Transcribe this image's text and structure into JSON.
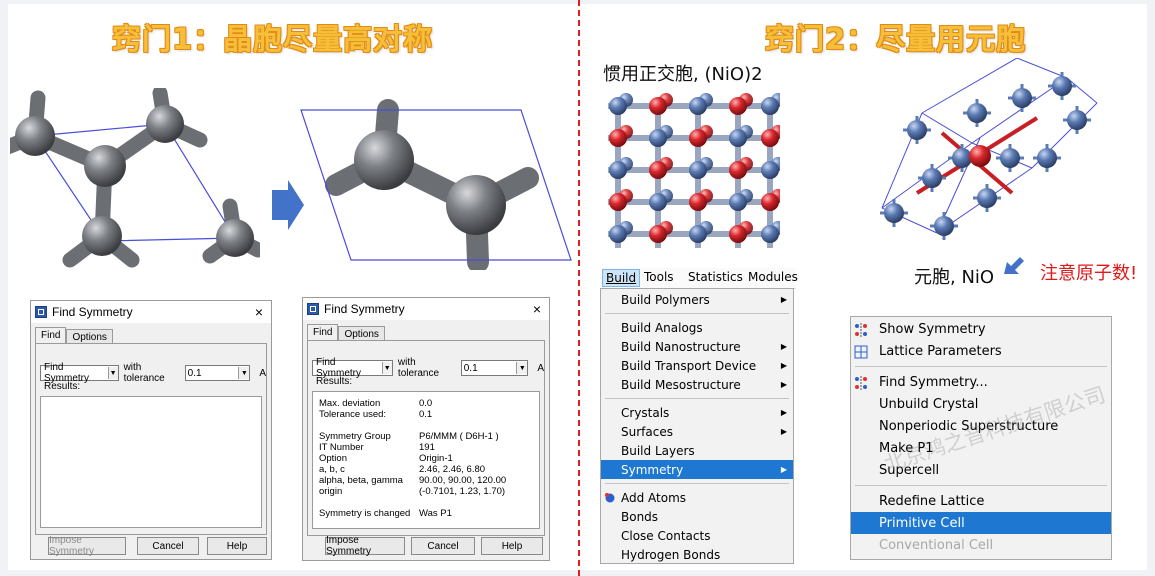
{
  "left_title": "窍门1：晶胞尽量高对称",
  "right_title": "窍门2：尽量用元胞",
  "conventional_caption": "惯用正交胞, (NiO)2",
  "primitive_caption": "元胞, NiO",
  "note": "注意原子数!",
  "watermark": "北京鸿之音科技有限公司",
  "colors": {
    "header_fill": "#f6bf3a",
    "divider": "#e02020",
    "atom_gray": "#6b6e72",
    "atom_blue": "#4d6fa8",
    "atom_red": "#d8282c",
    "cell_line": "#4a4ed8",
    "arrow": "#4273c8",
    "menu_select": "#1e78d2",
    "note_red": "#e01818"
  },
  "dialog1": {
    "title": "Find Symmetry",
    "close": "×",
    "tabs": [
      "Find",
      "Options"
    ],
    "find_combo": "Find Symmetry",
    "tolerance_label": "with tolerance",
    "tolerance_value": "0.1",
    "unit": "A",
    "results_label": "Results:",
    "buttons": [
      "Impose Symmetry",
      "Cancel",
      "Help"
    ]
  },
  "dialog2": {
    "title": "Find Symmetry",
    "close": "×",
    "tabs": [
      "Find",
      "Options"
    ],
    "find_combo": "Find Symmetry",
    "tolerance_label": "with tolerance",
    "tolerance_value": "0.1",
    "unit": "A",
    "results_label": "Results:",
    "results": [
      [
        "Max. deviation",
        "0.0"
      ],
      [
        "Tolerance used:",
        "0.1"
      ],
      [
        "",
        ""
      ],
      [
        "Symmetry Group",
        "P6/MMM  ( D6H-1 )"
      ],
      [
        "IT Number",
        "191"
      ],
      [
        "Option",
        "Origin-1"
      ],
      [
        "a, b, c",
        "2.46,  2.46,  6.80"
      ],
      [
        "alpha, beta, gamma",
        "90.00,  90.00,  120.00"
      ],
      [
        "origin",
        "(-0.7101,  1.23,  1.70)"
      ],
      [
        "",
        ""
      ],
      [
        "Symmetry is changed",
        "Was P1"
      ]
    ],
    "buttons": [
      "Impose Symmetry",
      "Cancel",
      "Help"
    ]
  },
  "menubar": [
    "Build",
    "Tools",
    "Statistics",
    "Modules"
  ],
  "build_menu": [
    {
      "label": "Build Polymers",
      "sub": true
    },
    {
      "sep": true
    },
    {
      "label": "Build Analogs"
    },
    {
      "label": "Build Nanostructure",
      "sub": true
    },
    {
      "label": "Build Transport Device",
      "sub": true
    },
    {
      "label": "Build Mesostructure",
      "sub": true
    },
    {
      "sep": true
    },
    {
      "label": "Crystals",
      "sub": true
    },
    {
      "label": "Surfaces",
      "sub": true
    },
    {
      "label": "Build Layers"
    },
    {
      "label": "Symmetry",
      "sub": true,
      "selected": true
    },
    {
      "sep": true
    },
    {
      "label": "Add Atoms",
      "icon": true
    },
    {
      "label": "Bonds"
    },
    {
      "label": "Close Contacts"
    },
    {
      "label": "Hydrogen Bonds"
    }
  ],
  "symmetry_menu": [
    {
      "label": "Show Symmetry",
      "icon": "symmetry"
    },
    {
      "label": "Lattice Parameters",
      "icon": "lattice"
    },
    {
      "sep": true
    },
    {
      "label": "Find Symmetry...",
      "icon": "symmetry"
    },
    {
      "label": "Unbuild Crystal"
    },
    {
      "label": "Nonperiodic Superstructure"
    },
    {
      "label": "Make P1"
    },
    {
      "label": "Supercell"
    },
    {
      "sep": true
    },
    {
      "label": "Redefine Lattice"
    },
    {
      "label": "Primitive Cell",
      "selected": true
    },
    {
      "label": "Conventional Cell",
      "disabled": true
    }
  ]
}
